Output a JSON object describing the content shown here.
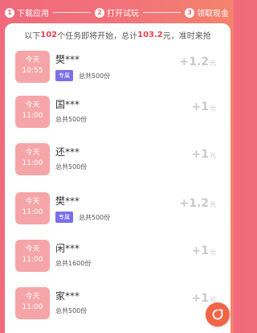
{
  "steps": [
    {
      "num": "1",
      "label": "下载应用"
    },
    {
      "num": "2",
      "label": "打开试玩"
    },
    {
      "num": "3",
      "label": "领取现金"
    }
  ],
  "notice": {
    "pre": "以下",
    "count": "102",
    "mid": "个任务即将开始，总计",
    "amount": "103.2",
    "post": "元，准时来抢"
  },
  "tasks": [
    {
      "day": "今天",
      "time": "10:55",
      "name": "樊***",
      "tag": "专属",
      "total": "总共500份",
      "reward": "+1.2",
      "unit": "元"
    },
    {
      "day": "今天",
      "time": "11:00",
      "name": "国***",
      "tag": "",
      "total": "总共500份",
      "reward": "+1",
      "unit": "元"
    },
    {
      "day": "今天",
      "time": "11:00",
      "name": "还***",
      "tag": "",
      "total": "总共500份",
      "reward": "+1",
      "unit": "元"
    },
    {
      "day": "今天",
      "time": "11:00",
      "name": "樊***",
      "tag": "专属",
      "total": "总共500份",
      "reward": "+1.2",
      "unit": "元"
    },
    {
      "day": "今天",
      "time": "11:00",
      "name": "闲***",
      "tag": "",
      "total": "总共1600份",
      "reward": "+1",
      "unit": "元"
    },
    {
      "day": "今天",
      "time": "11:00",
      "name": "家***",
      "tag": "",
      "total": "总共500份",
      "reward": "+1",
      "unit": "元"
    }
  ],
  "fab": {
    "icon": "refresh-icon"
  }
}
